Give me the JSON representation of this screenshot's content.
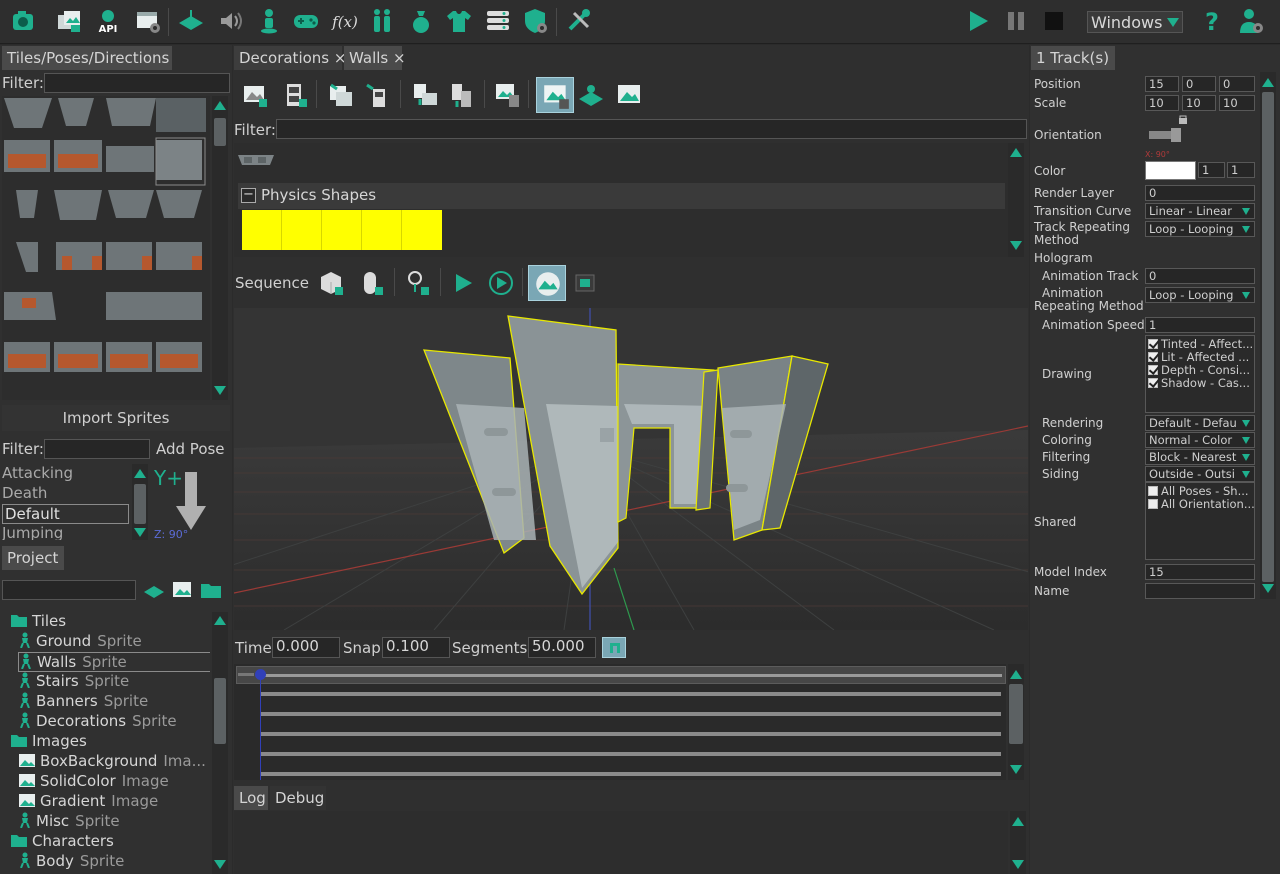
{
  "toolbar": {
    "left_icons": [
      "camera-icon",
      "images-icon",
      "api-icon",
      "settings-window-icon",
      "plane-icon",
      "speaker-icon",
      "person-pin-icon",
      "gamepad-icon",
      "function-icon",
      "people-icon",
      "money-bag-icon",
      "shirt-icon",
      "list-icon",
      "shield-gear-icon",
      "tools-icon"
    ],
    "api_label": "API",
    "fx_label": "f(x)",
    "platform": "Windows",
    "help_label": "?"
  },
  "left": {
    "tiles_tab": "Tiles/Poses/Directions",
    "filter_label": "Filter:",
    "import_sprites": "Import Sprites",
    "pose_filter_label": "Filter:",
    "add_pose": "Add Pose",
    "poses": [
      "Attacking",
      "Death",
      "Default",
      "Jumping"
    ],
    "selected_pose": "Default",
    "y_label": "Y+",
    "z_label": "Z: 90°"
  },
  "project": {
    "tab": "Project",
    "tree": [
      {
        "label": "Tiles",
        "type": "folder",
        "sub": ""
      },
      {
        "label": "Ground",
        "type": "sprite",
        "sub": "Sprite"
      },
      {
        "label": "Walls",
        "type": "sprite",
        "sub": "Sprite",
        "selected": true
      },
      {
        "label": "Stairs",
        "type": "sprite",
        "sub": "Sprite"
      },
      {
        "label": "Banners",
        "type": "sprite",
        "sub": "Sprite"
      },
      {
        "label": "Decorations",
        "type": "sprite",
        "sub": "Sprite"
      },
      {
        "label": "Images",
        "type": "folder",
        "sub": ""
      },
      {
        "label": "BoxBackground",
        "type": "image",
        "sub": "Ima..."
      },
      {
        "label": "SolidColor",
        "type": "image",
        "sub": "Image"
      },
      {
        "label": "Gradient",
        "type": "image",
        "sub": "Image"
      },
      {
        "label": "Misc",
        "type": "sprite",
        "sub": "Sprite"
      },
      {
        "label": "Characters",
        "type": "folder",
        "sub": ""
      },
      {
        "label": "Body",
        "type": "sprite",
        "sub": "Sprite"
      }
    ]
  },
  "center": {
    "tabs": [
      {
        "label": "Decorations"
      },
      {
        "label": "Walls"
      }
    ],
    "close_glyph": "×",
    "filter_label": "Filter:",
    "physics_shapes": "Physics Shapes",
    "collapse_glyph": "−",
    "sequence_label": "Sequence",
    "time_label": "Time",
    "time_value": "0.000",
    "snap_label": "Snap",
    "snap_value": "0.100",
    "segments_label": "Segments",
    "segments_value": "50.000",
    "log_tab": "Log",
    "debug_tab": "Debug",
    "accent_color": "#ffff00"
  },
  "right": {
    "tab": "1 Track(s)",
    "position_label": "Position",
    "position": [
      "15",
      "0",
      "0"
    ],
    "scale_label": "Scale",
    "scale": [
      "10",
      "10",
      "10"
    ],
    "orientation_label": "Orientation",
    "orientation_x": "X: 90°",
    "color_label": "Color",
    "color_a": "1",
    "color_b": "1",
    "render_layer_label": "Render Layer",
    "render_layer": "0",
    "transition_curve_label": "Transition Curve",
    "transition_curve": "Linear - Linear",
    "track_repeat_label_1": "Track Repeating",
    "track_repeat_label_2": "Method",
    "track_repeat": "Loop - Looping",
    "hologram_label": "Hologram",
    "anim_track_label": "Animation Track",
    "anim_track": "0",
    "anim_repeat_label_1": "Animation",
    "anim_repeat_label_2": "Repeating Method",
    "anim_repeat": "Loop - Looping",
    "anim_speed_label": "Animation Speed",
    "anim_speed": "1",
    "drawing_label": "Drawing",
    "drawing_opts": [
      "Tinted - Affect...",
      "Lit - Affected ...",
      "Depth - Consi...",
      "Shadow - Cas..."
    ],
    "rendering_label": "Rendering",
    "rendering": "Default - Defau",
    "coloring_label": "Coloring",
    "coloring": "Normal - Color",
    "filtering_label": "Filtering",
    "filtering": "Block - Nearest",
    "siding_label": "Siding",
    "siding": "Outside - Outsi",
    "siding_opts": [
      "All Poses - Sh...",
      "All Orientation..."
    ],
    "shared_label": "Shared",
    "model_index_label": "Model Index",
    "model_index": "15",
    "name_label": "Name",
    "name": ""
  }
}
